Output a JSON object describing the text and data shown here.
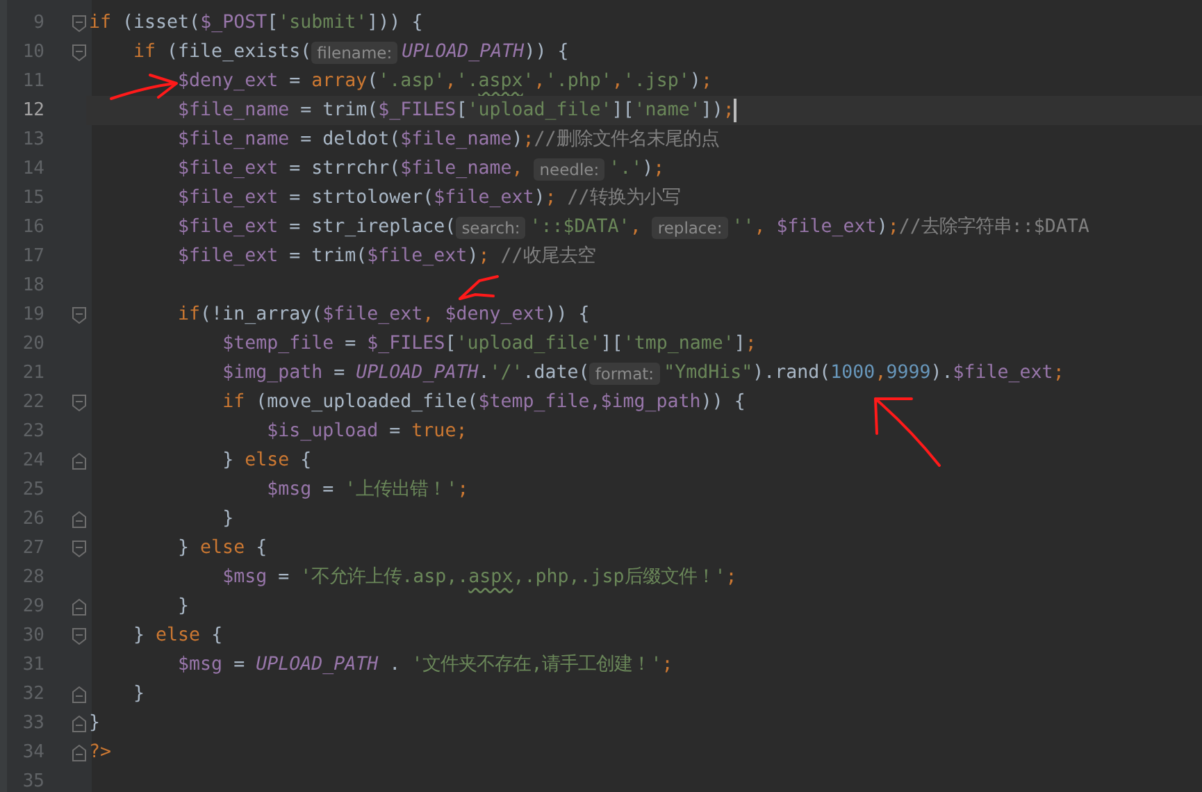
{
  "editor": {
    "lines": [
      {
        "number": "9",
        "fold_marker": {
          "kind": "start"
        },
        "current": false,
        "tokens": [
          {
            "kind": "kw",
            "text": "if"
          },
          {
            "kind": "plain",
            "text": " (isset("
          },
          {
            "kind": "var",
            "text": "$_POST"
          },
          {
            "kind": "plain",
            "text": "["
          },
          {
            "kind": "str",
            "text": "'submit'"
          },
          {
            "kind": "plain",
            "text": "])) {"
          }
        ],
        "children": [
          {
            "number": "10",
            "fold_marker": {
              "kind": "start"
            },
            "current": false,
            "tokens": [
              {
                "kind": "kw",
                "text": "if"
              },
              {
                "kind": "plain",
                "text": " (file_exists("
              },
              {
                "kind": "hint",
                "text": "filename:"
              },
              {
                "kind": "const",
                "text": "UPLOAD_PATH"
              },
              {
                "kind": "plain",
                "text": ")) {"
              }
            ],
            "children": [
              {
                "number": "11",
                "current": false,
                "tokens": [
                  {
                    "kind": "var",
                    "text": "$deny_ext"
                  },
                  {
                    "kind": "plain",
                    "text": " = "
                  },
                  {
                    "kind": "kw",
                    "text": "array"
                  },
                  {
                    "kind": "plain",
                    "text": "("
                  },
                  {
                    "kind": "str",
                    "text": "'.asp'"
                  },
                  {
                    "kind": "punct",
                    "text": ","
                  },
                  {
                    "kind": "str",
                    "text": "'."
                  },
                  {
                    "kind": "typo",
                    "text": "aspx"
                  },
                  {
                    "kind": "str",
                    "text": "'"
                  },
                  {
                    "kind": "punct",
                    "text": ","
                  },
                  {
                    "kind": "str",
                    "text": "'.php'"
                  },
                  {
                    "kind": "punct",
                    "text": ","
                  },
                  {
                    "kind": "str",
                    "text": "'.jsp'"
                  },
                  {
                    "kind": "plain",
                    "text": ")"
                  },
                  {
                    "kind": "punct",
                    "text": ";"
                  }
                ]
              },
              {
                "number": "12",
                "current": true,
                "tokens": [
                  {
                    "kind": "var",
                    "text": "$file_name"
                  },
                  {
                    "kind": "plain",
                    "text": " = trim("
                  },
                  {
                    "kind": "var",
                    "text": "$_FILES"
                  },
                  {
                    "kind": "plain",
                    "text": "["
                  },
                  {
                    "kind": "str",
                    "text": "'upload_file'"
                  },
                  {
                    "kind": "plain",
                    "text": "]["
                  },
                  {
                    "kind": "str",
                    "text": "'name'"
                  },
                  {
                    "kind": "plain",
                    "text": "])"
                  },
                  {
                    "kind": "punct",
                    "text": ";"
                  }
                ]
              },
              {
                "number": "13",
                "current": false,
                "tokens": [
                  {
                    "kind": "var",
                    "text": "$file_name"
                  },
                  {
                    "kind": "plain",
                    "text": " = deldot("
                  },
                  {
                    "kind": "var",
                    "text": "$file_name"
                  },
                  {
                    "kind": "plain",
                    "text": ")"
                  },
                  {
                    "kind": "punct",
                    "text": ";"
                  },
                  {
                    "kind": "comment",
                    "text": "//删除文件名末尾的点"
                  }
                ]
              },
              {
                "number": "14",
                "current": false,
                "tokens": [
                  {
                    "kind": "var",
                    "text": "$file_ext"
                  },
                  {
                    "kind": "plain",
                    "text": " = strrchr("
                  },
                  {
                    "kind": "var",
                    "text": "$file_name"
                  },
                  {
                    "kind": "punct",
                    "text": ", "
                  },
                  {
                    "kind": "hint",
                    "text": "needle:"
                  },
                  {
                    "kind": "str",
                    "text": "'.'"
                  },
                  {
                    "kind": "plain",
                    "text": ")"
                  },
                  {
                    "kind": "punct",
                    "text": ";"
                  }
                ]
              },
              {
                "number": "15",
                "current": false,
                "tokens": [
                  {
                    "kind": "var",
                    "text": "$file_ext"
                  },
                  {
                    "kind": "plain",
                    "text": " = strtolower("
                  },
                  {
                    "kind": "var",
                    "text": "$file_ext"
                  },
                  {
                    "kind": "plain",
                    "text": ")"
                  },
                  {
                    "kind": "punct",
                    "text": ";"
                  },
                  {
                    "kind": "comment",
                    "text": " //转换为小写"
                  }
                ]
              },
              {
                "number": "16",
                "current": false,
                "tokens": [
                  {
                    "kind": "var",
                    "text": "$file_ext"
                  },
                  {
                    "kind": "plain",
                    "text": " = str_ireplace("
                  },
                  {
                    "kind": "hint",
                    "text": "search:"
                  },
                  {
                    "kind": "str",
                    "text": "'::$DATA'"
                  },
                  {
                    "kind": "punct",
                    "text": ", "
                  },
                  {
                    "kind": "hint",
                    "text": "replace:"
                  },
                  {
                    "kind": "str",
                    "text": "''"
                  },
                  {
                    "kind": "punct",
                    "text": ", "
                  },
                  {
                    "kind": "var",
                    "text": "$file_ext"
                  },
                  {
                    "kind": "plain",
                    "text": ")"
                  },
                  {
                    "kind": "punct",
                    "text": ";"
                  },
                  {
                    "kind": "comment",
                    "text": "//去除字符串::$DATA"
                  }
                ]
              },
              {
                "number": "17",
                "current": false,
                "tokens": [
                  {
                    "kind": "var",
                    "text": "$file_ext"
                  },
                  {
                    "kind": "plain",
                    "text": " = trim("
                  },
                  {
                    "kind": "var",
                    "text": "$file_ext"
                  },
                  {
                    "kind": "plain",
                    "text": ")"
                  },
                  {
                    "kind": "punct",
                    "text": ";"
                  },
                  {
                    "kind": "comment",
                    "text": " //收尾去空"
                  }
                ]
              },
              {
                "number": "18",
                "current": false
              },
              {
                "number": "19",
                "fold_marker": {
                  "kind": "start"
                },
                "current": false,
                "tokens": [
                  {
                    "kind": "kw",
                    "text": "if"
                  },
                  {
                    "kind": "plain",
                    "text": "(!in_array("
                  },
                  {
                    "kind": "var",
                    "text": "$file_ext"
                  },
                  {
                    "kind": "punct",
                    "text": ", "
                  },
                  {
                    "kind": "var",
                    "text": "$deny_ext"
                  },
                  {
                    "kind": "plain",
                    "text": ")) {"
                  }
                ],
                "children": [
                  {
                    "number": "20",
                    "current": false,
                    "tokens": [
                      {
                        "kind": "var",
                        "text": "$temp_file"
                      },
                      {
                        "kind": "plain",
                        "text": " = "
                      },
                      {
                        "kind": "var",
                        "text": "$_FILES"
                      },
                      {
                        "kind": "plain",
                        "text": "["
                      },
                      {
                        "kind": "str",
                        "text": "'upload_file'"
                      },
                      {
                        "kind": "plain",
                        "text": "]["
                      },
                      {
                        "kind": "str",
                        "text": "'tmp_name'"
                      },
                      {
                        "kind": "plain",
                        "text": "]"
                      },
                      {
                        "kind": "punct",
                        "text": ";"
                      }
                    ]
                  },
                  {
                    "number": "21",
                    "current": false,
                    "tokens": [
                      {
                        "kind": "var",
                        "text": "$img_path"
                      },
                      {
                        "kind": "plain",
                        "text": " = "
                      },
                      {
                        "kind": "const",
                        "text": "UPLOAD_PATH"
                      },
                      {
                        "kind": "plain",
                        "text": "."
                      },
                      {
                        "kind": "str",
                        "text": "'/'"
                      },
                      {
                        "kind": "plain",
                        "text": ".date("
                      },
                      {
                        "kind": "hint",
                        "text": "format:"
                      },
                      {
                        "kind": "str",
                        "text": "\"YmdHis\""
                      },
                      {
                        "kind": "plain",
                        "text": ").rand("
                      },
                      {
                        "kind": "num",
                        "text": "1000"
                      },
                      {
                        "kind": "punct",
                        "text": ","
                      },
                      {
                        "kind": "num",
                        "text": "9999"
                      },
                      {
                        "kind": "plain",
                        "text": ")."
                      },
                      {
                        "kind": "var",
                        "text": "$file_ext"
                      },
                      {
                        "kind": "punct",
                        "text": ";"
                      }
                    ]
                  },
                  {
                    "number": "22",
                    "fold_marker": {
                      "kind": "start"
                    },
                    "current": false,
                    "tokens": [
                      {
                        "kind": "kw",
                        "text": "if"
                      },
                      {
                        "kind": "plain",
                        "text": " (move_uploaded_file("
                      },
                      {
                        "kind": "var",
                        "text": "$temp_file,$img_path"
                      },
                      {
                        "kind": "plain",
                        "text": ")) {"
                      }
                    ],
                    "children": [
                      {
                        "number": "23",
                        "current": false,
                        "tokens": [
                          {
                            "kind": "var",
                            "text": "$is_upload"
                          },
                          {
                            "kind": "plain",
                            "text": " = "
                          },
                          {
                            "kind": "kw",
                            "text": "true"
                          },
                          {
                            "kind": "punct",
                            "text": ";"
                          }
                        ]
                      }
                    ]
                  },
                  {
                    "number": "24",
                    "fold_marker": {
                      "kind": "end"
                    },
                    "current": false,
                    "tokens": [
                      {
                        "kind": "plain",
                        "text": "} "
                      },
                      {
                        "kind": "kw",
                        "text": "else"
                      },
                      {
                        "kind": "plain",
                        "text": " {"
                      }
                    ],
                    "children": [
                      {
                        "number": "25",
                        "current": false,
                        "tokens": [
                          {
                            "kind": "var",
                            "text": "$msg"
                          },
                          {
                            "kind": "plain",
                            "text": " = "
                          },
                          {
                            "kind": "str",
                            "text": "'上传出错！'"
                          },
                          {
                            "kind": "punct",
                            "text": ";"
                          }
                        ]
                      }
                    ]
                  },
                  {
                    "number": "26",
                    "fold_marker": {
                      "kind": "end"
                    },
                    "current": false,
                    "tokens": [
                      {
                        "kind": "plain",
                        "text": "}"
                      }
                    ]
                  }
                ]
              },
              {
                "number": "27",
                "fold_marker": {
                  "kind": "start"
                },
                "current": false,
                "tokens": [
                  {
                    "kind": "plain",
                    "text": "} "
                  },
                  {
                    "kind": "kw",
                    "text": "else"
                  },
                  {
                    "kind": "plain",
                    "text": " {"
                  }
                ],
                "children": [
                  {
                    "number": "28",
                    "current": false,
                    "tokens": [
                      {
                        "kind": "var",
                        "text": "$msg"
                      },
                      {
                        "kind": "plain",
                        "text": " = "
                      },
                      {
                        "kind": "str",
                        "text": "'不允许上传.asp,."
                      },
                      {
                        "kind": "typo",
                        "text": "aspx"
                      },
                      {
                        "kind": "str",
                        "text": ",.php,.jsp后缀文件！'"
                      },
                      {
                        "kind": "punct",
                        "text": ";"
                      }
                    ]
                  }
                ]
              },
              {
                "number": "29",
                "fold_marker": {
                  "kind": "end"
                },
                "current": false,
                "tokens": [
                  {
                    "kind": "plain",
                    "text": "}"
                  }
                ]
              }
            ]
          },
          {
            "number": "30",
            "fold_marker": {
              "kind": "start"
            },
            "current": false,
            "tokens": [
              {
                "kind": "plain",
                "text": "} "
              },
              {
                "kind": "kw",
                "text": "else"
              },
              {
                "kind": "plain",
                "text": " {"
              }
            ],
            "children": [
              {
                "number": "31",
                "current": false,
                "tokens": [
                  {
                    "kind": "var",
                    "text": "$msg"
                  },
                  {
                    "kind": "plain",
                    "text": " = "
                  },
                  {
                    "kind": "const",
                    "text": "UPLOAD_PATH"
                  },
                  {
                    "kind": "plain",
                    "text": " . "
                  },
                  {
                    "kind": "str",
                    "text": "'文件夹不存在,请手工创建！'"
                  },
                  {
                    "kind": "punct",
                    "text": ";"
                  }
                ]
              }
            ]
          },
          {
            "number": "32",
            "fold_marker": {
              "kind": "end"
            },
            "current": false,
            "tokens": [
              {
                "kind": "plain",
                "text": "}"
              }
            ]
          }
        ]
      },
      {
        "number": "33",
        "fold_marker": {
          "kind": "end"
        },
        "current": false,
        "tokens": [
          {
            "kind": "plain",
            "text": "}"
          }
        ]
      },
      {
        "number": "34",
        "fold_marker": {
          "kind": "end"
        },
        "current": false,
        "tokens": [
          {
            "kind": "kw",
            "text": "?>"
          }
        ]
      },
      {
        "number": "35",
        "current": false
      }
    ]
  }
}
